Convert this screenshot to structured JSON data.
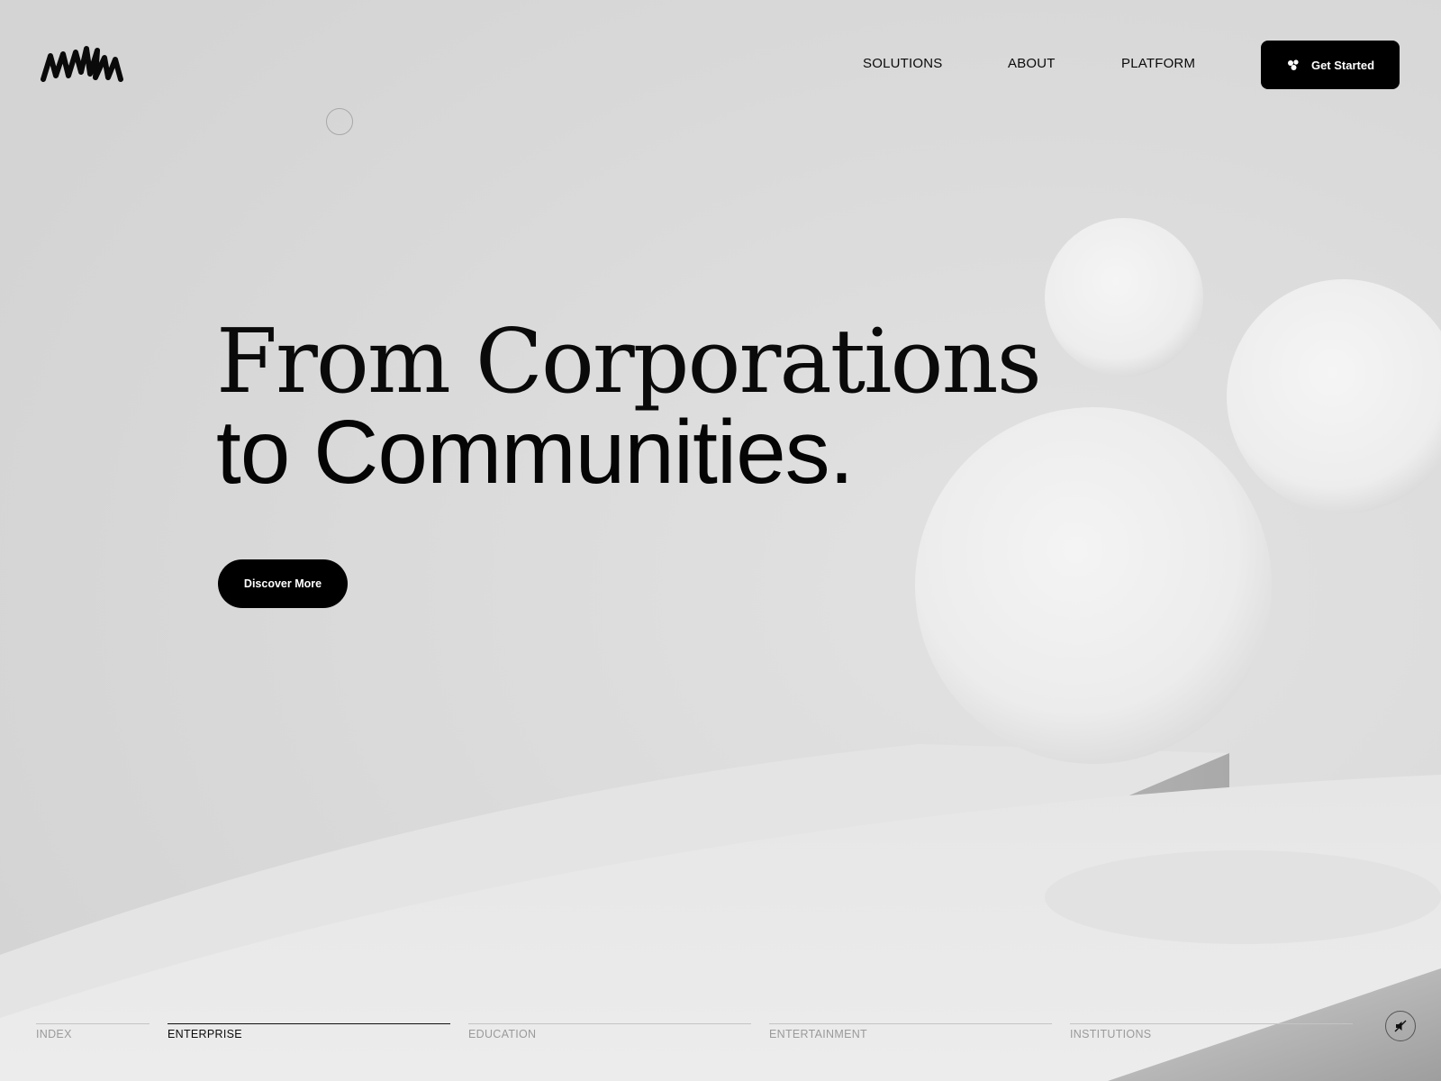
{
  "brand": {
    "logo_name": "with"
  },
  "nav": {
    "items": [
      {
        "label": "SOLUTIONS"
      },
      {
        "label": "ABOUT"
      },
      {
        "label": "PLATFORM"
      }
    ],
    "cta_label": "Get Started",
    "cta_icon": "cluster-dots-icon"
  },
  "hero": {
    "line1": "From Corporations",
    "line2": "to Communities.",
    "button_label": "Discover More"
  },
  "tabs": [
    {
      "label": "INDEX",
      "active": false
    },
    {
      "label": "ENTERPRISE",
      "active": true
    },
    {
      "label": "EDUCATION",
      "active": false
    },
    {
      "label": "ENTERTAINMENT",
      "active": false
    },
    {
      "label": "INSTITUTIONS",
      "active": false
    }
  ],
  "audio": {
    "icon": "speaker-muted-icon"
  },
  "colors": {
    "background": "#d8d8d8",
    "accent": "#000000",
    "muted_text": "#9a9a9a"
  }
}
